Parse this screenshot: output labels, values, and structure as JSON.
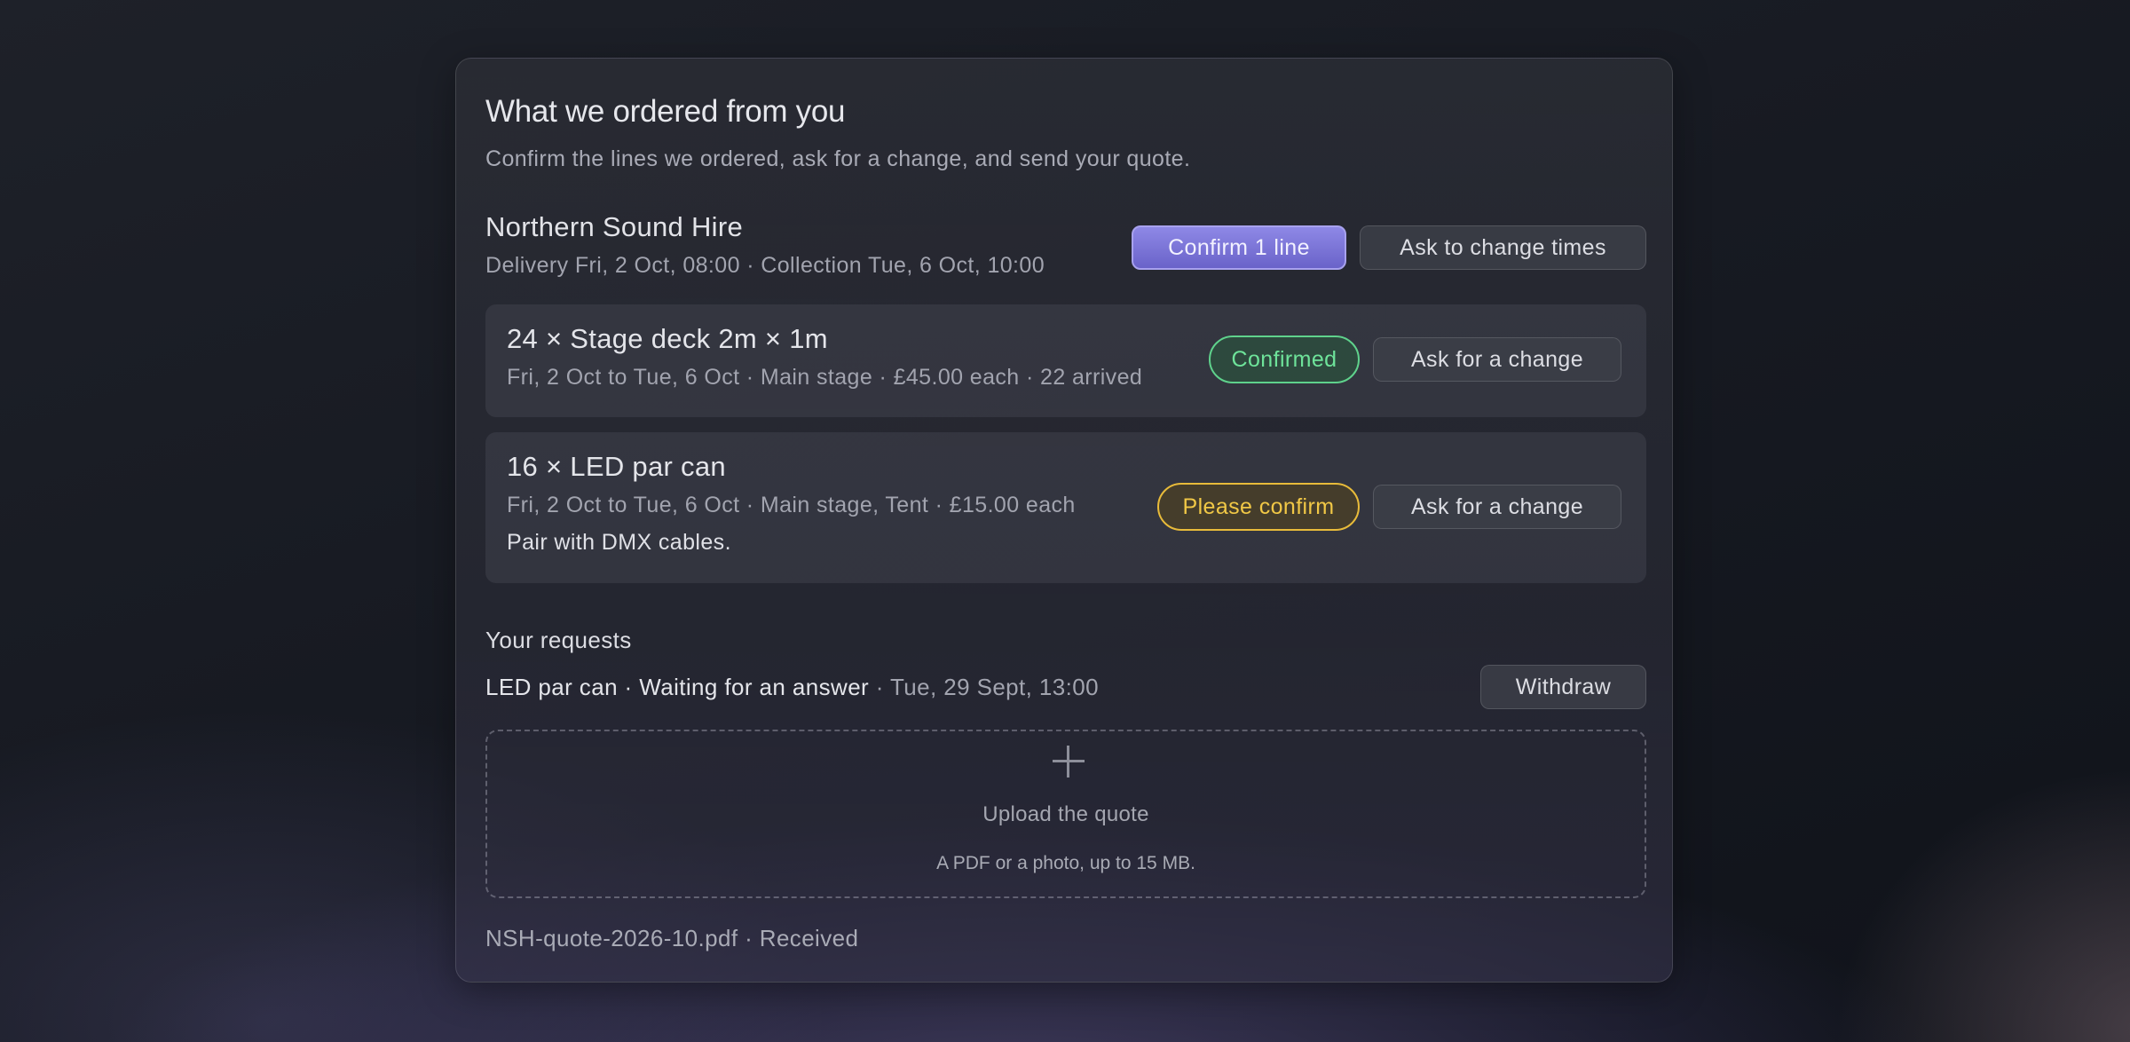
{
  "header": {
    "title": "What we ordered from you",
    "subtitle": "Confirm the lines we ordered, ask for a change, and send your quote."
  },
  "supplier": {
    "name": "Northern Sound Hire",
    "schedule": "Delivery Fri, 2 Oct, 08:00 · Collection Tue, 6 Oct, 10:00",
    "confirm_label": "Confirm 1 line",
    "change_times_label": "Ask to change times"
  },
  "lines": [
    {
      "title": "24 × Stage deck 2m × 1m",
      "meta": "Fri, 2 Oct to Tue, 6 Oct · Main stage · £45.00 each · 22 arrived",
      "status": "Confirmed",
      "change_label": "Ask for a change"
    },
    {
      "title": "16 × LED par can",
      "meta": "Fri, 2 Oct to Tue, 6 Oct · Main stage, Tent · £15.00 each",
      "note": "Pair with DMX cables.",
      "status": "Please confirm",
      "change_label": "Ask for a change"
    }
  ],
  "requests": {
    "heading": "Your requests",
    "items": [
      {
        "text": "LED par can · Waiting for an answer",
        "time": " · Tue, 29 Sept, 13:00",
        "withdraw_label": "Withdraw"
      }
    ]
  },
  "upload": {
    "icon": "plus-icon",
    "title": "Upload the quote",
    "hint": "A PDF or a photo, up to 15 MB."
  },
  "file": {
    "status_text": "NSH-quote-2026-10.pdf · Received"
  },
  "colors": {
    "accent": "#7a73d8",
    "confirmed": "#5fd28c",
    "pending": "#e8bb3a"
  }
}
